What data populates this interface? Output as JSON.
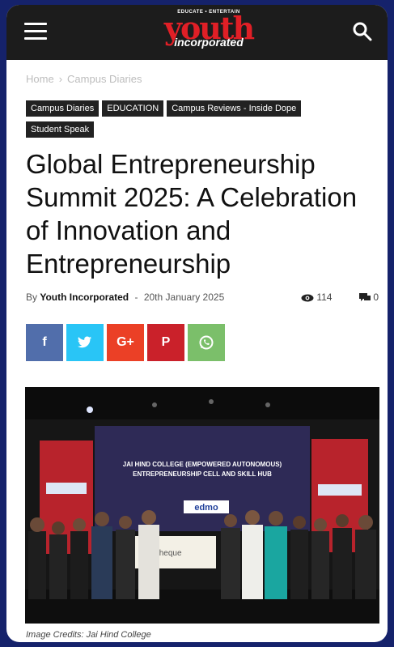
{
  "header": {
    "logo_tagline": "EDUCATE • ENTERTAIN",
    "logo_main": "youth",
    "logo_sub": "incorporated"
  },
  "breadcrumb": {
    "home": "Home",
    "separator": "›",
    "current": "Campus Diaries"
  },
  "tags": [
    "Campus Diaries",
    "EDUCATION",
    "Campus Reviews - Inside Dope",
    "Student Speak"
  ],
  "article": {
    "title": "Global Entrepreneurship Summit 2025: A Celebration of Innovation and Entrepreneurship",
    "by": "By",
    "author": "Youth Incorporated",
    "dash": "-",
    "date": "20th January 2025",
    "views": "114",
    "comments": "0"
  },
  "share": {
    "facebook": "f",
    "twitter": "t",
    "googleplus": "G+",
    "pinterest": "P"
  },
  "photo": {
    "banner_line1": "JAI HIND COLLEGE (EMPOWERED AUTONOMOUS)",
    "banner_line2": "ENTREPRENEURSHIP CELL AND SKILL HUB",
    "sponsor": "edmo",
    "cheque": "Cheque"
  },
  "caption": "Image Credits: Jai Hind College",
  "colors": {
    "topbar": "#1c1c1c",
    "logo_red": "#e01f26",
    "frame": "#15226b"
  }
}
